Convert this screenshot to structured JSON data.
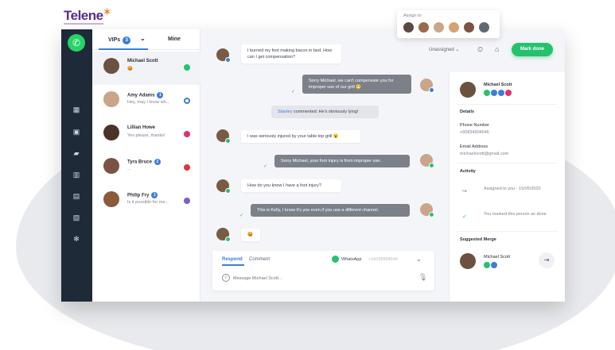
{
  "brand": {
    "name": "Telene",
    "mark": "✶"
  },
  "assign": {
    "label": "Assign to",
    "avatar_colors": [
      "#5a4a3e",
      "#9a6b4c",
      "#c9a58a",
      "#d4a373",
      "#7b5342",
      "#5f6a73"
    ]
  },
  "toolbar": {
    "status": "Unassigned",
    "mark_done": "Mark done"
  },
  "tabs": {
    "vips": "VIPs",
    "vips_count": "3",
    "mine": "Mine"
  },
  "conversations": [
    {
      "name": "Michael Scott",
      "preview": "😡",
      "channel_color": "#25c26e",
      "badge": ""
    },
    {
      "name": "Amy Adams",
      "preview": "Hey, may I know wh...",
      "channel_color": "#3b7ddd",
      "badge": "1"
    },
    {
      "name": "Lillian Howe",
      "preview": "Yes please, thanks!",
      "channel_color": "#e1306c",
      "badge": ""
    },
    {
      "name": "Tyra Bruce",
      "preview": "...",
      "channel_color": "#d9363e",
      "badge": "2"
    },
    {
      "name": "Philip Fry",
      "preview": "Is it possible for me...",
      "channel_color": "#7b5fc7",
      "badge": "1"
    }
  ],
  "messages": {
    "m1": "I burned my foot making bacon in bed. How can I get compensation?",
    "m2": "Sorry Michael, we can't compensate you for improper use of our grill 😬",
    "note_who": "Stanley",
    "note_rest": "commented: He's obviously lying!",
    "m3": "I was seriously injured by your table top grill 😮",
    "m4": "Sorry Michael, your foot injury is from improper use.",
    "m5": "How do you know I have a foot injury?",
    "m6": "This is Kelly, I know it's you even if you use a different channel.",
    "m7": "😡"
  },
  "composer": {
    "respond": "Respond",
    "comment": "Comment",
    "channel": "WhatsApp",
    "number": "+16038904546",
    "placeholder": "Message Michael Scott..."
  },
  "contact": {
    "name": "Michael Scott",
    "details_h": "Details",
    "phone_label": "Phone Number",
    "phone": "+60834904546",
    "email_label": "Email Address",
    "email": "michaelscott@gmail.com",
    "activity_h": "Activity",
    "act1": "Assigned to you - 15/05/2020",
    "act2": "You marked this person as done",
    "merge_h": "Suggested Merge",
    "merge_name": "Michael Scott"
  },
  "colors": {
    "accent": "#25c26e",
    "blue": "#3b7ddd",
    "rail": "#1f2a38"
  }
}
